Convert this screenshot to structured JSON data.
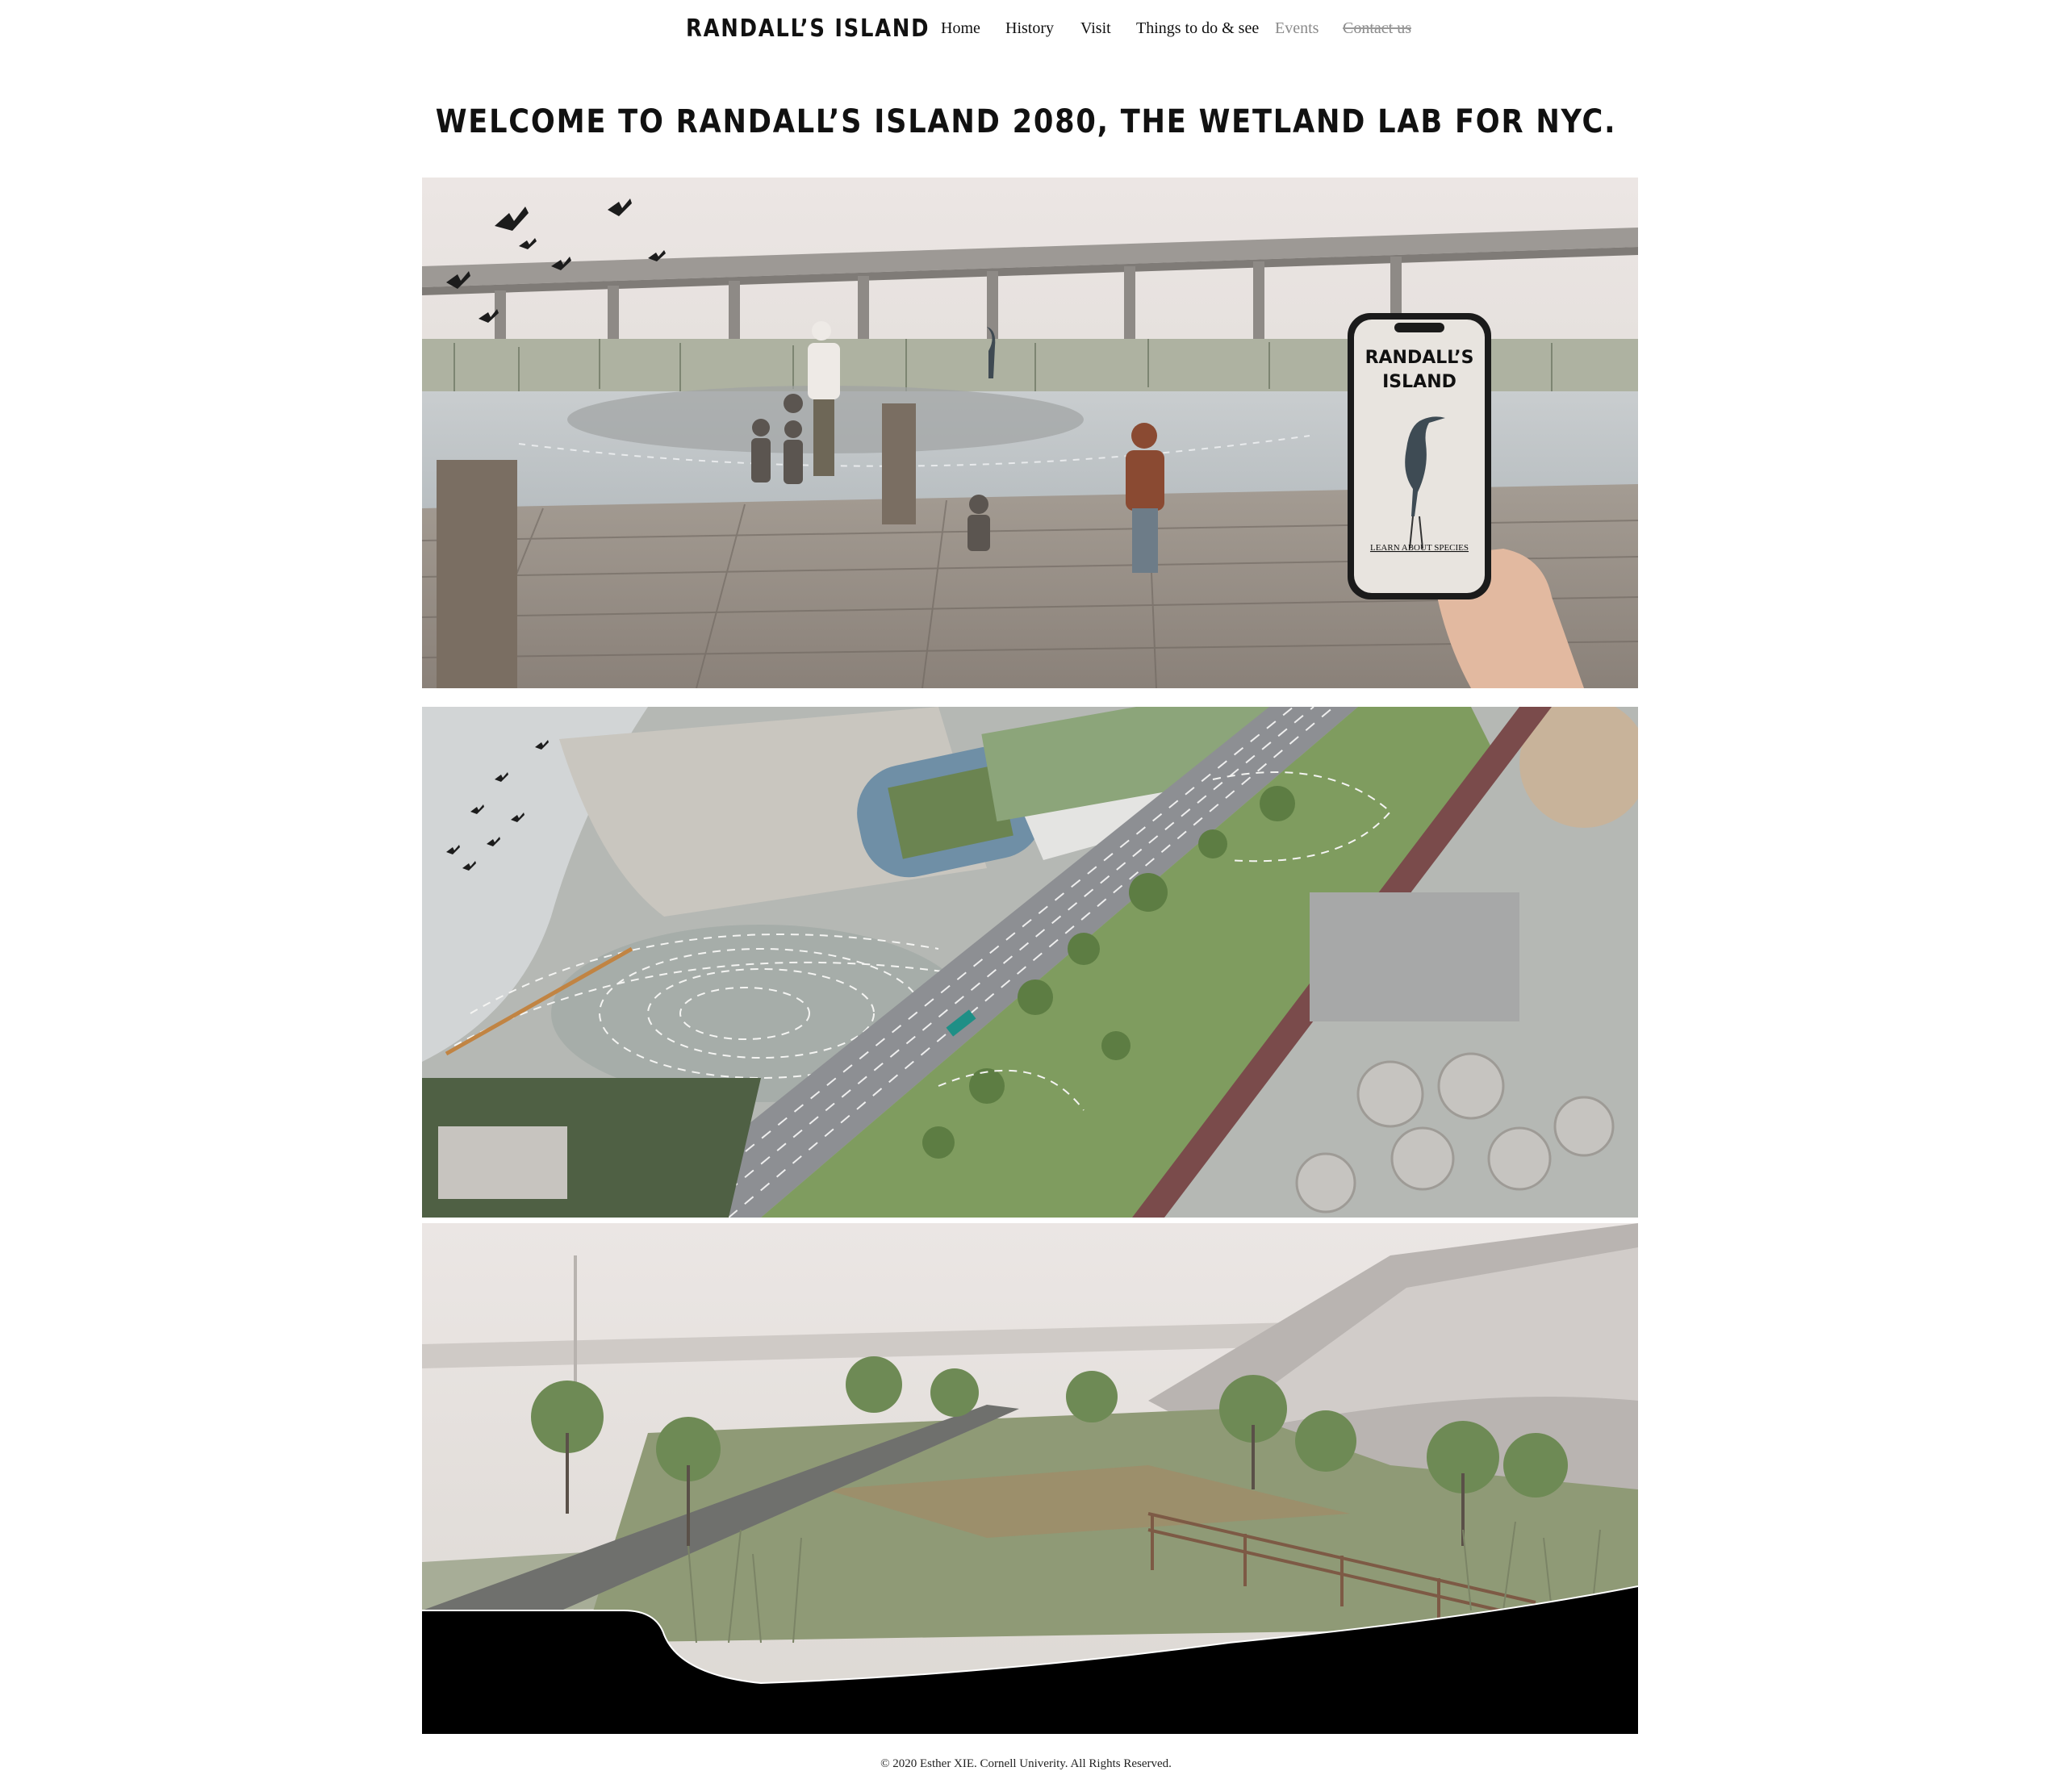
{
  "header": {
    "brand": "RANDALL’S ISLAND",
    "nav": [
      {
        "label": "Home"
      },
      {
        "label": "History"
      },
      {
        "label": "Visit"
      },
      {
        "label": "Things to do & see"
      },
      {
        "label": "Events"
      },
      {
        "label": "Contact us"
      }
    ]
  },
  "main": {
    "headline": "WELCOME TO RANDALL’S ISLAND 2080, THE WETLAND LAB FOR NYC.",
    "panels": [
      {
        "name": "boardwalk-rendering",
        "phone": {
          "title_line1": "RANDALL’S",
          "title_line2": "ISLAND",
          "link": "LEARN ABOUT SPECIES"
        }
      },
      {
        "name": "aerial-site-plan"
      },
      {
        "name": "wetland-section-rendering"
      }
    ]
  },
  "footer": {
    "copyright": "© 2020 Esther XIE. Cornell Univerity. All Rights Reserved."
  },
  "colors": {
    "text": "#111111",
    "muted_nav": "#8a8a8a",
    "background": "#ffffff"
  }
}
